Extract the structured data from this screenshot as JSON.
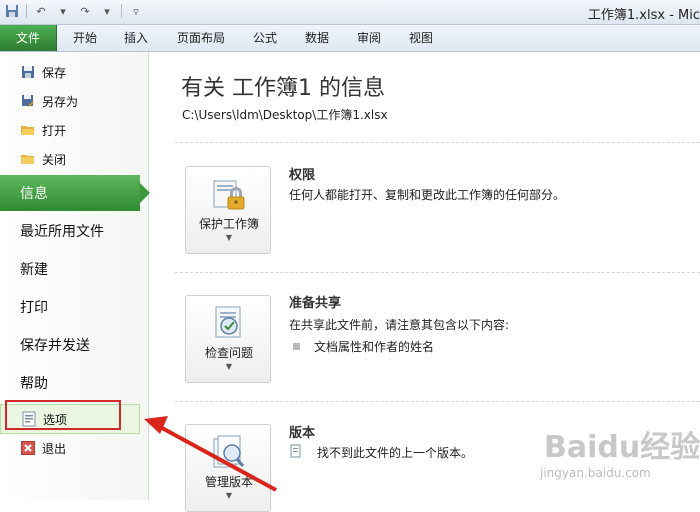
{
  "window": {
    "title": "工作簿1.xlsx - Mic"
  },
  "ribbon": {
    "tabs": [
      {
        "label": "文件"
      },
      {
        "label": "开始"
      },
      {
        "label": "插入"
      },
      {
        "label": "页面布局"
      },
      {
        "label": "公式"
      },
      {
        "label": "数据"
      },
      {
        "label": "审阅"
      },
      {
        "label": "视图"
      }
    ]
  },
  "backstage": {
    "small_items": [
      {
        "label": "保存",
        "icon": "save-icon"
      },
      {
        "label": "另存为",
        "icon": "save-as-icon"
      },
      {
        "label": "打开",
        "icon": "open-folder-icon"
      },
      {
        "label": "关闭",
        "icon": "close-folder-icon"
      }
    ],
    "big_items": [
      {
        "label": "信息"
      },
      {
        "label": "最近所用文件"
      },
      {
        "label": "新建"
      },
      {
        "label": "打印"
      },
      {
        "label": "保存并发送"
      },
      {
        "label": "帮助"
      }
    ],
    "bottom_items": [
      {
        "label": "选项",
        "icon": "options-icon"
      },
      {
        "label": "退出",
        "icon": "exit-icon"
      }
    ]
  },
  "info": {
    "title": "有关 工作簿1 的信息",
    "path": "C:\\Users\\ldm\\Desktop\\工作簿1.xlsx",
    "sections": [
      {
        "button_label": "保护工作簿",
        "icon": "protect-workbook-icon",
        "title": "权限",
        "desc": "任何人都能打开、复制和更改此工作簿的任何部分。"
      },
      {
        "button_label": "检查问题",
        "icon": "check-issues-icon",
        "title": "准备共享",
        "desc": "在共享此文件前，请注意其包含以下内容:",
        "bullet": "文档属性和作者的姓名"
      },
      {
        "button_label": "管理版本",
        "icon": "manage-versions-icon",
        "title": "版本",
        "desc": "找不到此文件的上一个版本。"
      }
    ]
  },
  "watermark": {
    "logo": "Baidu经验",
    "url": "jingyan.baidu.com"
  },
  "colors": {
    "file_tab": "#2e7d32",
    "active_item": "#3c9a3c",
    "highlight_box": "#d12a2a"
  }
}
